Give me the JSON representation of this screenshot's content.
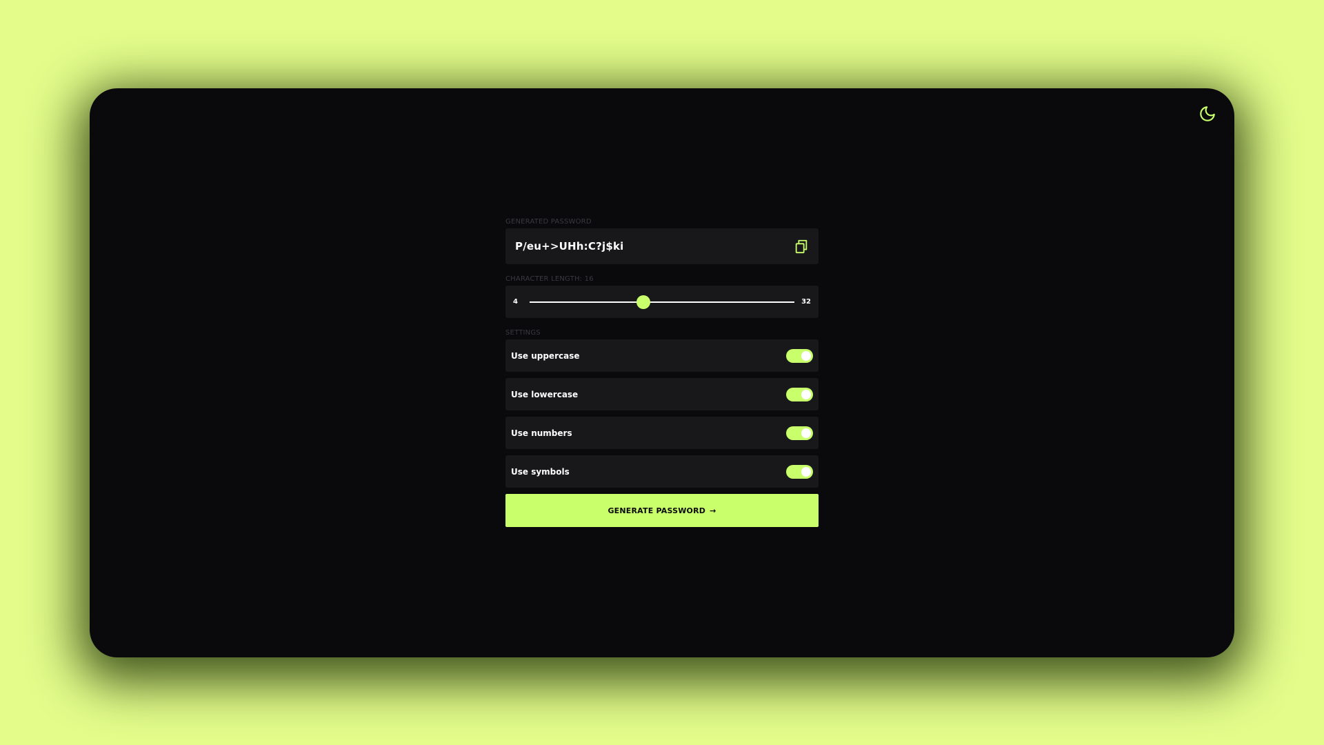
{
  "colors": {
    "page_background": "#e3fc8a",
    "window_background": "#0a0a0d",
    "card_background": "#18181b",
    "accent": "#c9ff6b",
    "label_muted": "#3a3a3f",
    "text": "#ffffff"
  },
  "header": {
    "theme_toggle_icon": "moon-icon"
  },
  "password": {
    "section_label": "GENERATED PASSWORD",
    "value": "P/eu+>UHh:C?j$ki",
    "copy_icon": "copy-icon"
  },
  "length": {
    "section_label": "CHARACTER LENGTH: 16",
    "min_label": "4",
    "max_label": "32",
    "min": 4,
    "max": 32,
    "value": 16
  },
  "settings": {
    "section_label": "SETTINGS",
    "items": [
      {
        "label": "Use uppercase",
        "enabled": true
      },
      {
        "label": "Use lowercase",
        "enabled": true
      },
      {
        "label": "Use numbers",
        "enabled": true
      },
      {
        "label": "Use symbols",
        "enabled": true
      }
    ]
  },
  "generate": {
    "label": "GENERATE PASSWORD",
    "arrow": "→",
    "icon": "arrow-right-icon"
  }
}
